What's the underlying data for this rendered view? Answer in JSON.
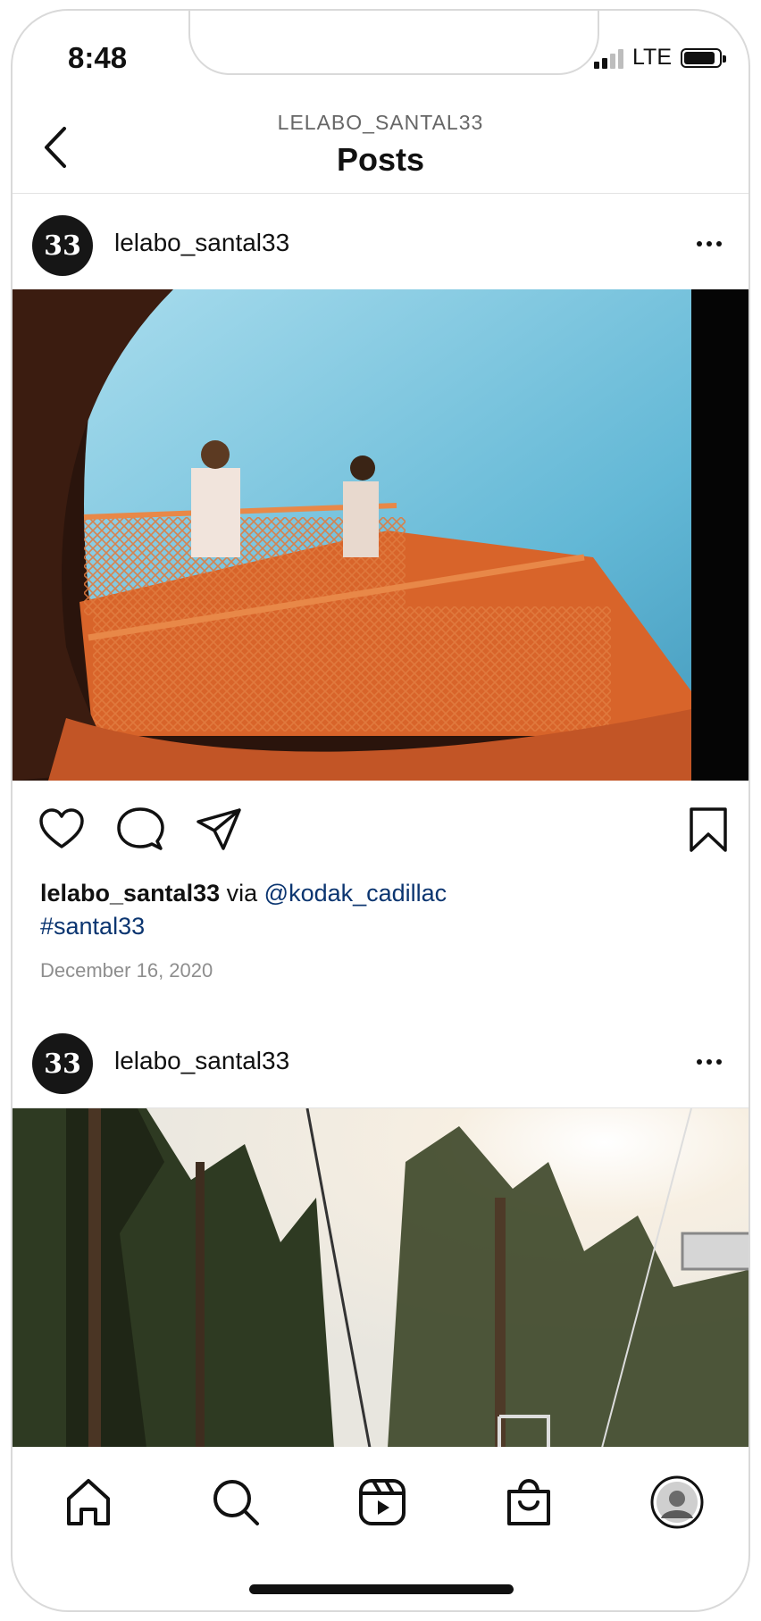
{
  "status_bar": {
    "time": "8:48",
    "network": "LTE"
  },
  "header": {
    "subtitle": "LELABO_SANTAL33",
    "title": "Posts"
  },
  "posts": [
    {
      "avatar_text": "33",
      "username": "lelabo_santal33",
      "caption": {
        "user": "lelabo_santal33",
        "via": "via",
        "mention": "@kodak_cadillac",
        "hashtag": "#santal33"
      },
      "date": "December 16, 2020"
    },
    {
      "avatar_text": "33",
      "username": "lelabo_santal33"
    }
  ],
  "action_icons": [
    "heart-icon",
    "comment-icon",
    "share-icon",
    "bookmark-icon"
  ],
  "tab_bar": {
    "icons": [
      "home-icon",
      "search-icon",
      "reels-icon",
      "shop-icon",
      "profile-avatar"
    ]
  },
  "colors": {
    "link": "#0b3570",
    "muted": "#8e8e8e",
    "orange": "#d8642a",
    "sky": "#8fd0e6"
  }
}
